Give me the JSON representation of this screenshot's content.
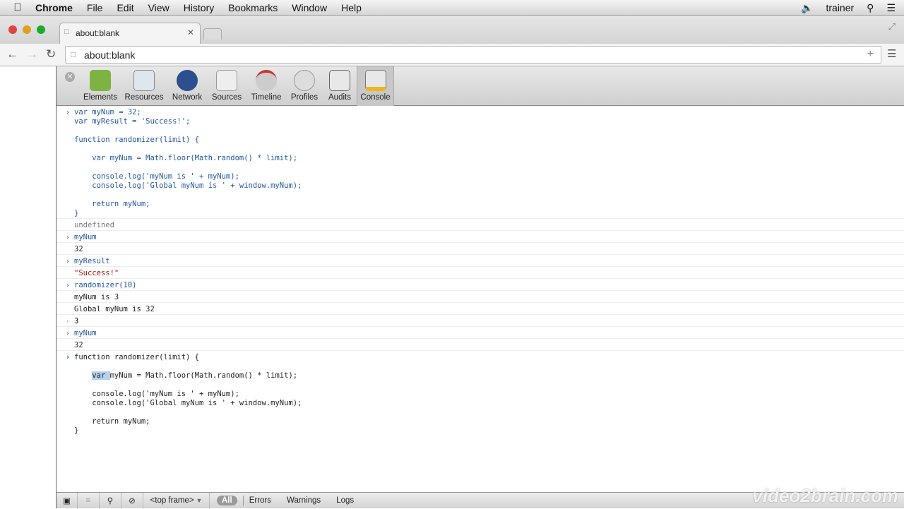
{
  "menubar": {
    "app": "Chrome",
    "items": [
      "File",
      "Edit",
      "View",
      "History",
      "Bookmarks",
      "Window",
      "Help"
    ],
    "user": "trainer"
  },
  "tab": {
    "title": "about:blank"
  },
  "address": {
    "url": "about:blank"
  },
  "devtools": {
    "panels": [
      "Elements",
      "Resources",
      "Network",
      "Sources",
      "Timeline",
      "Profiles",
      "Audits",
      "Console"
    ],
    "selected": "Console"
  },
  "console": {
    "entries": [
      {
        "type": "input",
        "text": "var myNum = 32;\nvar myResult = 'Success!';\n\nfunction randomizer(limit) {\n\n    var myNum = Math.floor(Math.random() * limit);\n\n    console.log('myNum is ' + myNum);\n    console.log('Global myNum is ' + window.myNum);\n\n    return myNum;\n}"
      },
      {
        "type": "undef",
        "text": "undefined"
      },
      {
        "type": "input",
        "text": "myNum"
      },
      {
        "type": "output",
        "text": "32"
      },
      {
        "type": "input",
        "text": "myResult"
      },
      {
        "type": "str",
        "text": "\"Success!\""
      },
      {
        "type": "input",
        "text": "randomizer(10)"
      },
      {
        "type": "output",
        "text": "myNum is 3"
      },
      {
        "type": "output",
        "text": "Global myNum is 32"
      },
      {
        "type": "ret",
        "text": "3"
      },
      {
        "type": "input",
        "text": "myNum"
      },
      {
        "type": "output",
        "text": "32"
      }
    ],
    "prompt": {
      "line1": "function randomizer(limit) {\n\n",
      "indent": "    ",
      "selected": "var ",
      "rest": "myNum = Math.floor(Math.random() * limit);\n\n    console.log('myNum is ' + myNum);\n    console.log('Global myNum is ' + window.myNum);\n\n    return myNum;\n}"
    }
  },
  "bottom": {
    "frame": "<top frame>",
    "filters": [
      "All",
      "Errors",
      "Warnings",
      "Logs"
    ]
  },
  "watermark": "video2brain.com"
}
